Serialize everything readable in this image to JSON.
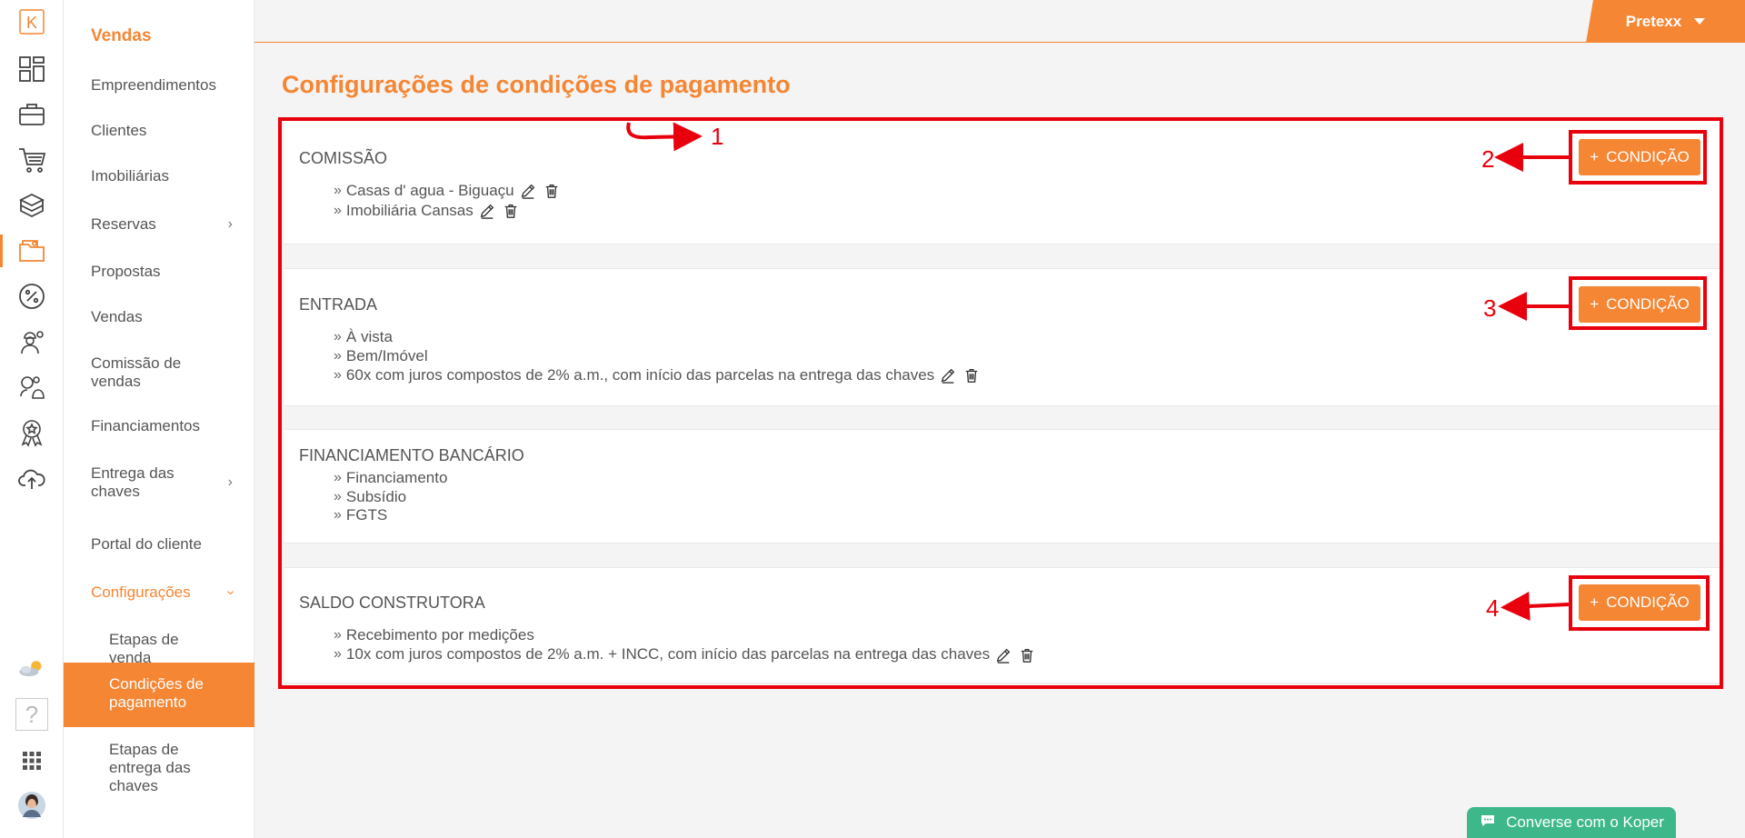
{
  "rail": {
    "logo": "K",
    "icons": [
      "logo-k-icon",
      "dashboard-icon",
      "briefcase-icon",
      "cart-icon",
      "boxes-icon",
      "folder-money-icon",
      "percent-icon",
      "worker-icon",
      "finance-people-icon",
      "award-icon",
      "cloud-upload-icon"
    ],
    "bottom_icons": [
      "weather-icon",
      "help-icon",
      "apps-grid-icon",
      "avatar"
    ],
    "help_text": "?"
  },
  "nav": {
    "title": "Vendas",
    "items": [
      {
        "label": "Empreendimentos"
      },
      {
        "label": "Clientes"
      },
      {
        "label": "Imobiliárias"
      },
      {
        "label": "Reservas"
      },
      {
        "label": "Propostas"
      },
      {
        "label": "Vendas"
      },
      {
        "label": "Comissão de vendas"
      },
      {
        "label": "Financiamentos"
      },
      {
        "label": "Entrega das chaves"
      },
      {
        "label": "Portal do cliente"
      },
      {
        "label": "Configurações"
      },
      {
        "label": "Etapas de venda"
      },
      {
        "label": "Condições de pagamento"
      },
      {
        "label": "Etapas de entrega das chaves"
      }
    ]
  },
  "header": {
    "user_name": "Pretexx"
  },
  "page": {
    "title": "Configurações de condições de pagamento"
  },
  "sections": [
    {
      "title": "COMISSÃO",
      "button": "CONDIÇÃO",
      "items": [
        "Casas d' agua - Biguaçu",
        "Imobiliária Cansas"
      ]
    },
    {
      "title": "ENTRADA",
      "button": "CONDIÇÃO",
      "items": [
        "À vista",
        "Bem/Imóvel",
        "60x com juros compostos de 2% a.m., com início das parcelas na entrega das chaves"
      ]
    },
    {
      "title": "FINANCIAMENTO BANCÁRIO",
      "items": [
        "Financiamento",
        "Subsídio",
        "FGTS"
      ]
    },
    {
      "title": "SALDO CONSTRUTORA",
      "button": "CONDIÇÃO",
      "items": [
        "Recebimento por medições",
        "10x com juros compostos de 2% a.m. + INCC, com início das parcelas na entrega das chaves"
      ]
    }
  ],
  "annotations": {
    "labels": [
      "1",
      "2",
      "3",
      "4"
    ],
    "color": "#e8000c"
  },
  "chat": {
    "label": "Converse com o Koper"
  },
  "colors": {
    "accent": "#f58634",
    "chat": "#3eb88b"
  }
}
